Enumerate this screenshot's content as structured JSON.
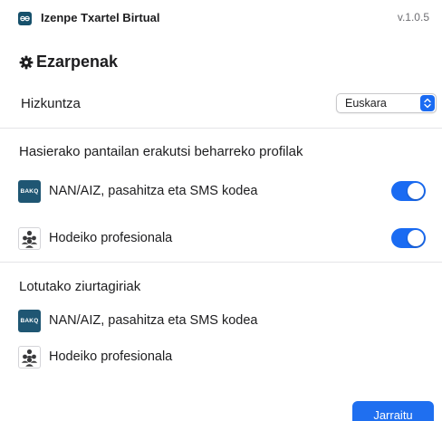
{
  "app": {
    "title": "Izenpe Txartel Birtual",
    "version": "v.1.0.5",
    "logo_icon": "izenpe-logo-icon",
    "logo_color": "#16506b"
  },
  "page": {
    "title": "Ezarpenak",
    "icon": "gear-icon"
  },
  "language": {
    "label": "Hizkuntza",
    "selected": "Euskara"
  },
  "home_profiles": {
    "title": "Hasierako pantailan erakutsi beharreko profilak",
    "items": [
      {
        "label": "NAN/AIZ, pasahitza eta SMS kodea",
        "icon": "bakq-icon",
        "icon_text": "BAKQ",
        "enabled": true
      },
      {
        "label": "Hodeiko profesionala",
        "icon": "people-icon",
        "enabled": true
      }
    ]
  },
  "linked_certificates": {
    "title": "Lotutako ziurtagiriak",
    "items": [
      {
        "label": "NAN/AIZ, pasahitza eta SMS kodea",
        "icon": "bakq-icon",
        "icon_text": "BAKQ"
      },
      {
        "label": "Hodeiko profesionala",
        "icon": "people-icon"
      }
    ]
  },
  "footer": {
    "continue_label": "Jarraitu"
  },
  "colors": {
    "accent": "#1a6bf2",
    "brand": "#1f5673",
    "divider": "#e5e5e7"
  }
}
